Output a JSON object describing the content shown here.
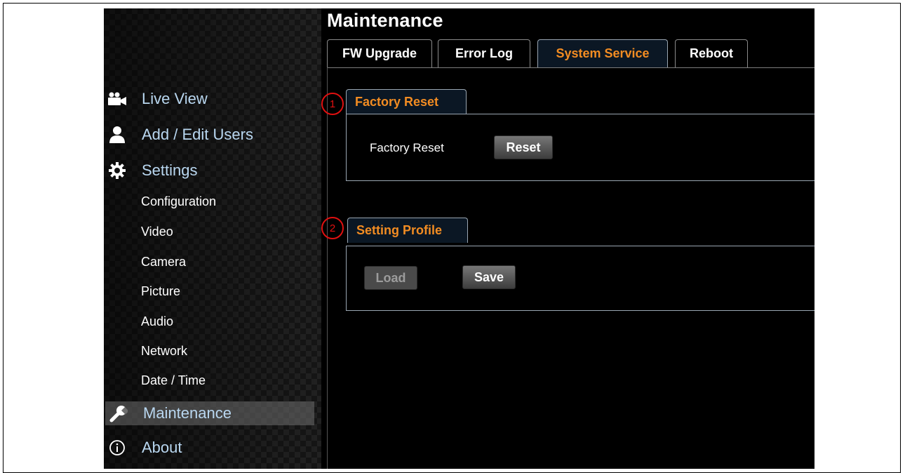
{
  "page_title": "Maintenance",
  "tabs": [
    {
      "label": "FW Upgrade"
    },
    {
      "label": "Error Log"
    },
    {
      "label": "System Service"
    },
    {
      "label": "Reboot"
    }
  ],
  "sidebar": {
    "main": [
      {
        "label": "Live View",
        "icon": "video-camera-icon"
      },
      {
        "label": "Add / Edit Users",
        "icon": "user-icon"
      },
      {
        "label": "Settings",
        "icon": "gear-icon"
      }
    ],
    "sub": [
      {
        "label": "Configuration"
      },
      {
        "label": "Video"
      },
      {
        "label": "Camera"
      },
      {
        "label": "Picture"
      },
      {
        "label": "Audio"
      },
      {
        "label": "Network"
      },
      {
        "label": "Date / Time"
      }
    ],
    "bottom": [
      {
        "label": "Maintenance",
        "icon": "wrench-icon"
      },
      {
        "label": "About",
        "icon": "info-icon"
      }
    ]
  },
  "factory_reset": {
    "badge": "1",
    "section_title": "Factory Reset",
    "row_label": "Factory Reset",
    "button": "Reset"
  },
  "setting_profile": {
    "badge": "2",
    "section_title": "Setting Profile",
    "load_button": "Load",
    "save_button": "Save"
  },
  "colors": {
    "accent_orange": "#f28c22",
    "nav_blue": "#b9d7f0",
    "annotation_red": "#e01010"
  }
}
